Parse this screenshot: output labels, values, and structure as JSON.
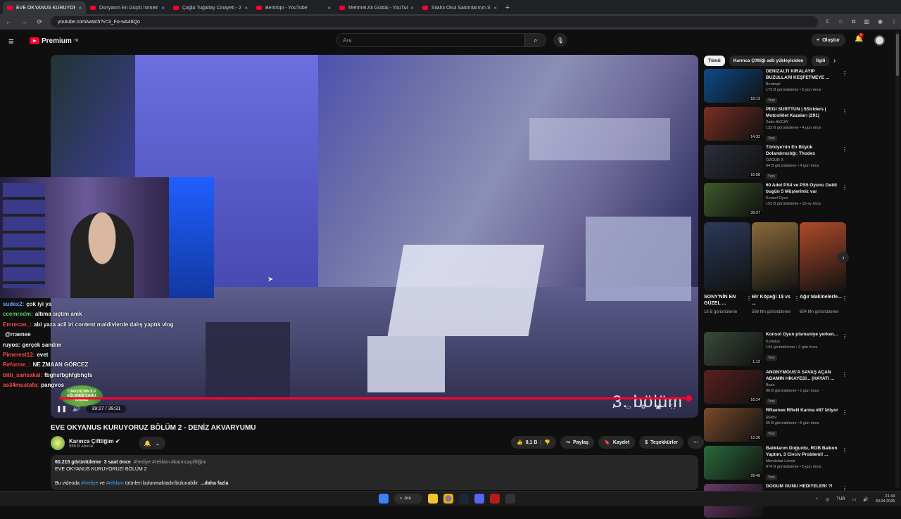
{
  "browser": {
    "tabs": [
      {
        "title": "EVE OKYANUS KURUYORU...",
        "active": true
      },
      {
        "title": "Dünyanın En Güçlü İsimleri Bu ...",
        "active": false
      },
      {
        "title": "Çağla Tuğaltay Cinayeti - 25 Yı...",
        "active": false
      },
      {
        "title": "Bentropi - YouTube",
        "active": false
      },
      {
        "title": "Mehmet Ali Güldal - YouTube",
        "active": false
      },
      {
        "title": "Silahlı Okul Saldırılarının Sebebi...",
        "active": false
      }
    ],
    "url": "youtube.com/watch?v=3_Fo-wA46Qo"
  },
  "header": {
    "logo_text": "Premium",
    "logo_sup": "TR",
    "search_placeholder": "Ara",
    "create_label": "Oluştur",
    "notification_count": "9"
  },
  "player": {
    "current_time": "39:27",
    "duration": "39:31",
    "progress_fraction": 0.998,
    "overlay_text": "3. bölüm",
    "overlay_logo_text": "TÜRKIYE'NIN İLK EĞLENCE CANLI KANALI"
  },
  "chat": [
    {
      "user": "sudex2:",
      "msg": "çok iyi ya",
      "color": "#6aa7ff"
    },
    {
      "user": "ccemredm:",
      "msg": "altıma sıçtım amk",
      "color": "#58d36e"
    },
    {
      "user": "Emrecan_:",
      "msg": "abi yaza acil iri content maldivlerde dalış yaptık vlog",
      "color": "#ff4d4d"
    },
    {
      "user": "",
      "msg": "@rraenee",
      "color": "#ffffff"
    },
    {
      "user": "ruyos:",
      "msg": "gerçek sandım",
      "color": "#ffffff"
    },
    {
      "user": "Pimerest12:",
      "msg": "evet",
      "color": "#ff4d4d"
    },
    {
      "user": "Reforme_:",
      "msg": "NE ZMAAN GÖRCEZ",
      "color": "#ff4d4d"
    },
    {
      "user": "bitti_sarisakal:",
      "msg": "fbghsfbghfgbhgfs",
      "color": "#ff4d4d"
    },
    {
      "user": "as34mustafa:",
      "msg": "pangvos",
      "color": "#ff4d4d"
    }
  ],
  "video": {
    "title": "EVE OKYANUS KURUYORUZ BÖLÜM 2 - DENİZ AKVARYUMU",
    "channel": "Karınca Çiftliğim",
    "subscribers": "988 B abone",
    "likes": "8,1 B",
    "share_label": "Paylaş",
    "save_label": "Kaydet",
    "thanks_label": "Teşekkürler",
    "views": "60.215 görüntüleme",
    "age": "3 saat önce",
    "hashtags": "#hediye #reklam #karıncaçiftliğim",
    "desc_line1": "EVE OKYANUS KURUYORUZ! BÖLÜM 2",
    "desc_line2_a": "Bu videoda",
    "desc_tag1": "#hediye",
    "desc_line2_b": "ve",
    "desc_tag2": "#reklam",
    "desc_line2_c": "ürünleri bulunmaktadır/bulunabilir.",
    "more_label": "...daha fazla"
  },
  "sidebar": {
    "chips": [
      "Tümü",
      "Karınca Çiftliği adlı yükleyiciden",
      "İlgili"
    ],
    "recommendations_top": [
      {
        "title": "DENİZALTI KİRALAYIP BUZULLARI KEŞFETMEYE ...",
        "channel": "Bentropi",
        "meta": "173 B görüntüleme • 5 gün önce",
        "duration": "18:13",
        "new": "Yeni",
        "color": "#0d4b8a"
      },
      {
        "title": "PEGİ SÜRTTÜN | 5Striders | Motosiklet Kazaları (291)",
        "channel": "Zafer AKCAY",
        "meta": "132 B görüntüleme • 4 gün önce",
        "duration": "14:32",
        "new": "Yeni",
        "color": "#7a2f22"
      },
      {
        "title": "Türkiye'nin En Büyük Dolandırıcılığı: Thodex",
        "channel": "ÖZGÜR X",
        "meta": "94 B görüntüleme • 4 gün önce",
        "duration": "16:58",
        "new": "Yeni",
        "color": "#2b2f3a"
      },
      {
        "title": "60 Adet PS4 ve PS5 Oyunu Geldi bugün 5 Müşterimiz var",
        "channel": "Konsol Oyun",
        "meta": "153 B görüntüleme • 10 ay önce",
        "duration": "39:37",
        "new": "",
        "color": "#3d5a2a"
      }
    ],
    "shorts": [
      {
        "title": "SONY'NİN EN GÜZEL ...",
        "views": "18 B görüntüleme",
        "color": "#2b3a5a"
      },
      {
        "title": "Bir Köpeği 1$ vs ...",
        "views": "598 Mn görüntüleme",
        "color": "#8a6a3a"
      },
      {
        "title": "Ağır Makinelerle...",
        "views": "604 Mn görüntüleme",
        "color": "#b04a2a"
      }
    ],
    "recommendations_bottom": [
      {
        "title": "Konsol Oyun pismaniye yerken...",
        "channel": "Kurtulus",
        "meta": "144 görüntüleme • 2 gün önce",
        "duration": "1:12",
        "new": "Yeni",
        "color": "#3a4a3a"
      },
      {
        "title": "ANONYMOUS'A SAVAŞ AÇAN ADAMIN HİKAYESİ... (HAYATI ...",
        "channel": "Baso",
        "meta": "96 B görüntüleme • 1 gün önce",
        "duration": "16:24",
        "new": "Yeni",
        "color": "#5a2020"
      },
      {
        "title": "RRaenee RReN Karma #87 İzliyor",
        "channel": "RReN",
        "meta": "55 B görüntüleme • 6 gün önce",
        "duration": "12:26",
        "new": "Yeni",
        "color": "#7a4a2a"
      },
      {
        "title": "Balıklarım Doğurdu, RGB Balkon Yaptım, 3 Civciv Problemi! ...",
        "channel": "Mendebar Lemur",
        "meta": "474 B görüntüleme • 5 gün önce",
        "duration": "28:49",
        "new": "Yeni",
        "color": "#2a6a3a"
      },
      {
        "title": "DOĞUM GÜNÜ HEDİYELERİ ?!",
        "channel": "",
        "meta": "",
        "duration": "",
        "new": "",
        "color": "#6a3a6a"
      }
    ]
  },
  "taskbar": {
    "search_label": "Ara",
    "lang": "TUR",
    "time": "21:43",
    "date": "30.04.2026"
  }
}
